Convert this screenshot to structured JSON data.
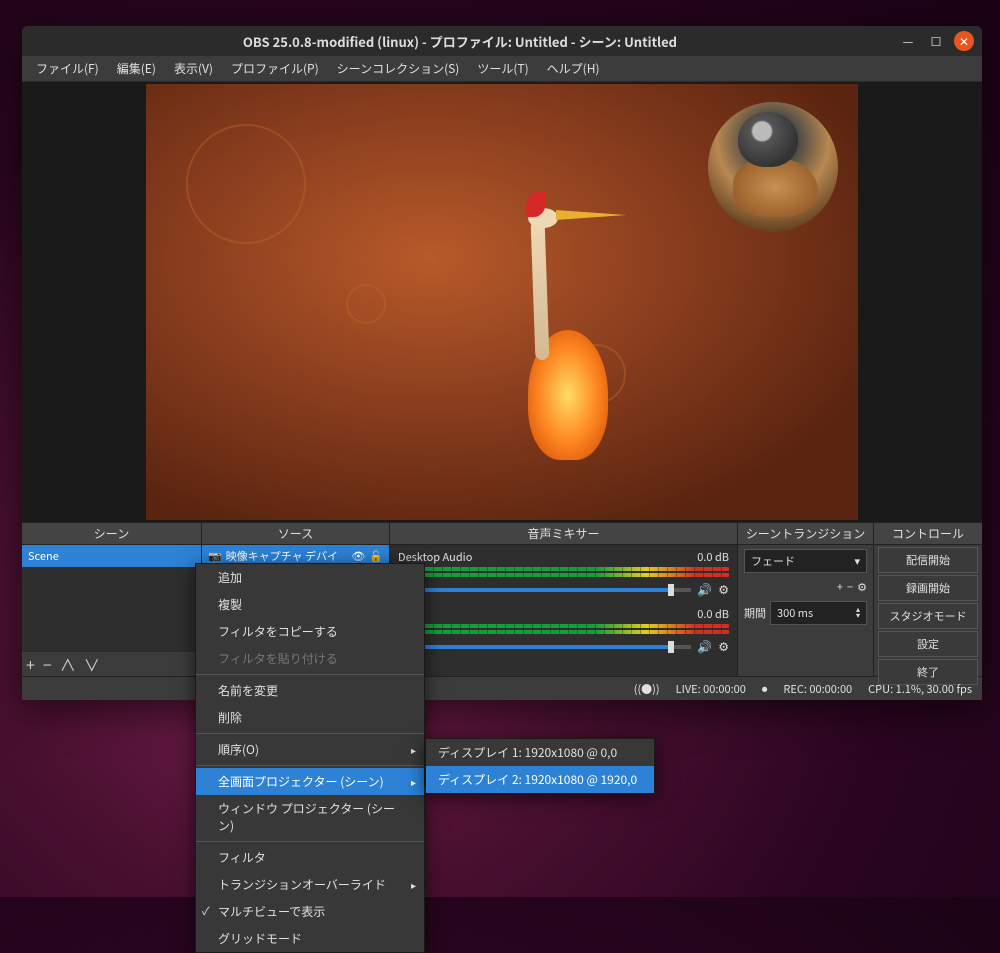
{
  "window": {
    "title": "OBS 25.0.8-modified (linux) - プロファイル: Untitled - シーン: Untitled"
  },
  "menubar": {
    "file": "ファイル(F)",
    "edit": "編集(E)",
    "view": "表示(V)",
    "profile": "プロファイル(P)",
    "scene_collection": "シーンコレクション(S)",
    "tools": "ツール(T)",
    "help": "ヘルプ(H)"
  },
  "panels": {
    "scenes": {
      "title": "シーン",
      "items": [
        "Scene"
      ]
    },
    "sources": {
      "title": "ソース",
      "items": [
        "映像キャプチャ デバイ"
      ]
    },
    "mixer": {
      "title": "音声ミキサー",
      "tracks": [
        {
          "name": "Desktop Audio",
          "level": "0.0 dB",
          "slider": 92
        },
        {
          "name": "",
          "level": "0.0 dB",
          "slider": 92
        }
      ]
    },
    "transitions": {
      "title": "シーントランジション",
      "selected": "フェード",
      "duration_label": "期間",
      "duration_value": "300 ms"
    },
    "controls": {
      "title": "コントロール",
      "buttons": [
        "配信開始",
        "録画開始",
        "スタジオモード",
        "設定",
        "終了"
      ]
    }
  },
  "statusbar": {
    "live": "LIVE: 00:00:00",
    "rec": "REC: 00:00:00",
    "cpu": "CPU: 1.1%, 30.00 fps"
  },
  "context_menu": {
    "items": [
      {
        "label": "追加",
        "type": "item"
      },
      {
        "label": "複製",
        "type": "item"
      },
      {
        "label": "フィルタをコピーする",
        "type": "item"
      },
      {
        "label": "フィルタを貼り付ける",
        "type": "disabled"
      },
      {
        "type": "sep"
      },
      {
        "label": "名前を変更",
        "type": "item"
      },
      {
        "label": "削除",
        "type": "item"
      },
      {
        "type": "sep"
      },
      {
        "label": "順序(O)",
        "type": "submenu"
      },
      {
        "type": "sep"
      },
      {
        "label": "全画面プロジェクター (シーン)",
        "type": "submenu-active"
      },
      {
        "label": "ウィンドウ プロジェクター (シーン)",
        "type": "item"
      },
      {
        "type": "sep"
      },
      {
        "label": "フィルタ",
        "type": "item"
      },
      {
        "label": "トランジションオーバーライド",
        "type": "submenu"
      },
      {
        "label": "マルチビューで表示",
        "type": "checked"
      },
      {
        "label": "グリッドモード",
        "type": "item"
      }
    ]
  },
  "submenu": {
    "items": [
      {
        "label": "ディスプレイ 1: 1920x1080 @ 0,0",
        "highlight": false
      },
      {
        "label": "ディスプレイ 2: 1920x1080 @ 1920,0",
        "highlight": true
      }
    ]
  }
}
